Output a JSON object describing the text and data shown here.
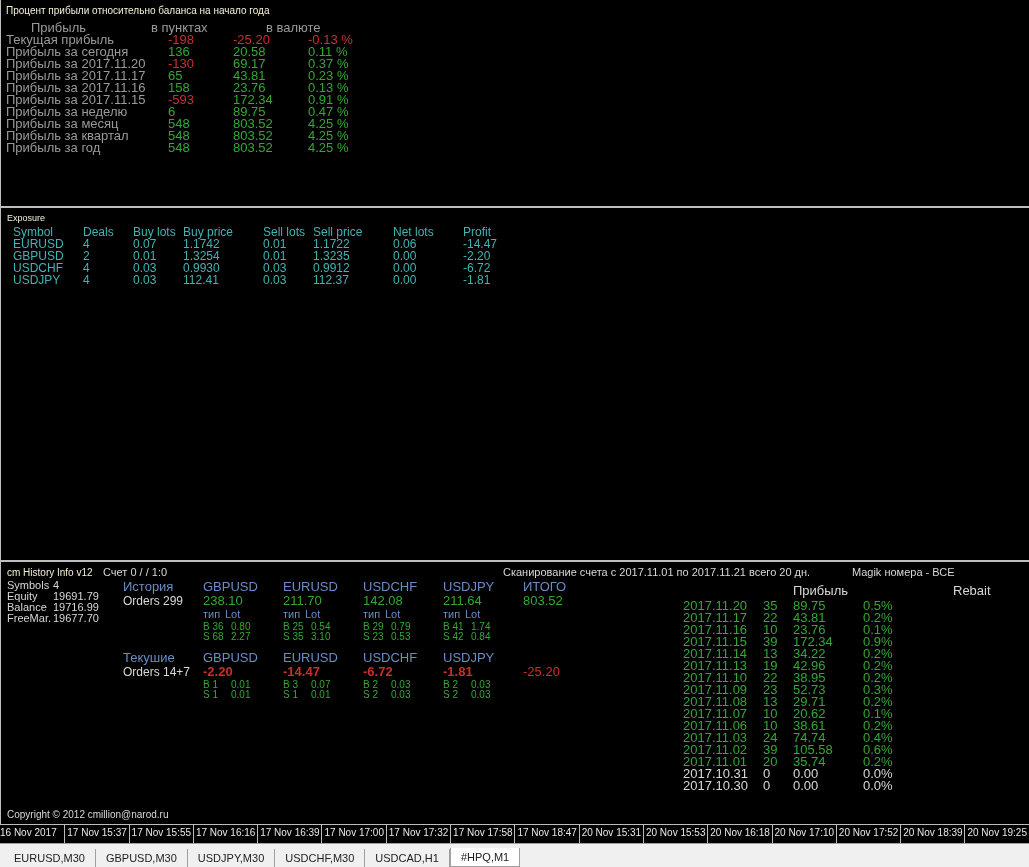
{
  "profit_panel": {
    "subtitle": "Процент прибыли относительно баланса на начало года",
    "headers": [
      "Прибыль",
      "в пунктах",
      "в валюте"
    ],
    "rows": [
      {
        "label": "Текущая прибыль",
        "cells": [
          {
            "text": "-198",
            "negative": true
          },
          {
            "text": "-25.20",
            "negative": true
          },
          {
            "text": "-0.13 %",
            "negative": true
          }
        ]
      },
      {
        "label": "Прибыль за сегодня",
        "cells": [
          {
            "text": "136",
            "negative": false
          },
          {
            "text": "20.58",
            "negative": false
          },
          {
            "text": "0.11 %",
            "negative": false
          }
        ]
      },
      {
        "label": "Прибыль за 2017.11.20",
        "cells": [
          {
            "text": "-130",
            "negative": true
          },
          {
            "text": "69.17",
            "negative": false
          },
          {
            "text": "0.37 %",
            "negative": false
          }
        ]
      },
      {
        "label": "Прибыль за 2017.11.17",
        "cells": [
          {
            "text": "65",
            "negative": false
          },
          {
            "text": "43.81",
            "negative": false
          },
          {
            "text": "0.23 %",
            "negative": false
          }
        ]
      },
      {
        "label": "Прибыль за 2017.11.16",
        "cells": [
          {
            "text": "158",
            "negative": false
          },
          {
            "text": "23.76",
            "negative": false
          },
          {
            "text": "0.13 %",
            "negative": false
          }
        ]
      },
      {
        "label": "Прибыль за 2017.11.15",
        "cells": [
          {
            "text": "-593",
            "negative": true
          },
          {
            "text": "172.34",
            "negative": false
          },
          {
            "text": "0.91 %",
            "negative": false
          }
        ]
      },
      {
        "label": "Прибыль за неделю",
        "cells": [
          {
            "text": "6",
            "negative": false
          },
          {
            "text": "89.75",
            "negative": false
          },
          {
            "text": "0.47 %",
            "negative": false
          }
        ]
      },
      {
        "label": "Прибыль за месяц",
        "cells": [
          {
            "text": "548",
            "negative": false
          },
          {
            "text": "803.52",
            "negative": false
          },
          {
            "text": "4.25 %",
            "negative": false
          }
        ]
      },
      {
        "label": "Прибыль за квартал",
        "cells": [
          {
            "text": "548",
            "negative": false
          },
          {
            "text": "803.52",
            "negative": false
          },
          {
            "text": "4.25 %",
            "negative": false
          }
        ]
      },
      {
        "label": "Прибыль за год",
        "cells": [
          {
            "text": "548",
            "negative": false
          },
          {
            "text": "803.52",
            "negative": false
          },
          {
            "text": "4.25 %",
            "negative": false
          }
        ]
      }
    ]
  },
  "exposure": {
    "title": "Exposure",
    "columns": [
      "Symbol",
      "Deals",
      "Buy lots",
      "Buy price",
      "Sell lots",
      "Sell price",
      "Net lots",
      "Profit"
    ],
    "rows": [
      [
        "EURUSD",
        "4",
        "0.07",
        "1.1742",
        "0.01",
        "1.1722",
        "0.06",
        "-14.47"
      ],
      [
        "GBPUSD",
        "2",
        "0.01",
        "1.3254",
        "0.01",
        "1.3235",
        "0.00",
        "-2.20"
      ],
      [
        "USDCHF",
        "4",
        "0.03",
        "0.9930",
        "0.03",
        "0.9912",
        "0.00",
        "-6.72"
      ],
      [
        "USDJPY",
        "4",
        "0.03",
        "112.41",
        "0.03",
        "112.37",
        "0.00",
        "-1.81"
      ]
    ]
  },
  "history_info": {
    "title": "cm History Info v12",
    "account": "Счет 0 /  / 1:0",
    "scan": "Сканирование счета с 2017.11.01 по 2017.11.21 всего 20 дн.",
    "magic": "Magik номера - ВСЕ",
    "stats": [
      {
        "label": "Symbols",
        "value": "4"
      },
      {
        "label": "Equity",
        "value": "19691.79"
      },
      {
        "label": "Balance",
        "value": "19716.99"
      },
      {
        "label": "FreeMar.",
        "value": "19677.70"
      }
    ],
    "sections": [
      {
        "title": "История",
        "orders": "Orders 299",
        "total_label": "ИТОГО",
        "total": "803.52",
        "total_negative": false,
        "symbols": [
          {
            "symbol": "GBPUSD",
            "value": "238.10",
            "negative": false,
            "line_headers": [
              "тип",
              "Lot"
            ],
            "lines": [
              [
                "B 36",
                "0.80"
              ],
              [
                "S 68",
                "2.27"
              ]
            ]
          },
          {
            "symbol": "EURUSD",
            "value": "211.70",
            "negative": false,
            "line_headers": [
              "тип",
              "Lot"
            ],
            "lines": [
              [
                "B 25",
                "0.54"
              ],
              [
                "S 35",
                "3.10"
              ]
            ]
          },
          {
            "symbol": "USDCHF",
            "value": "142.08",
            "negative": false,
            "line_headers": [
              "тип",
              "Lot"
            ],
            "lines": [
              [
                "B 29",
                "0.79"
              ],
              [
                "S 23",
                "0.53"
              ]
            ]
          },
          {
            "symbol": "USDJPY",
            "value": "211.64",
            "negative": false,
            "line_headers": [
              "тип",
              "Lot"
            ],
            "lines": [
              [
                "B 41",
                "1.74"
              ],
              [
                "S 42",
                "0.84"
              ]
            ]
          }
        ]
      },
      {
        "title": "Текушие",
        "orders": "Orders 14+7",
        "total": "-25.20",
        "total_negative": true,
        "symbols": [
          {
            "symbol": "GBPUSD",
            "value": "-2.20",
            "negative": true,
            "lines": [
              [
                "B 1",
                "0.01"
              ],
              [
                "S 1",
                "0.01"
              ]
            ]
          },
          {
            "symbol": "EURUSD",
            "value": "-14.47",
            "negative": true,
            "lines": [
              [
                "B 3",
                "0.07"
              ],
              [
                "S 1",
                "0.01"
              ]
            ]
          },
          {
            "symbol": "USDCHF",
            "value": "-6.72",
            "negative": true,
            "lines": [
              [
                "B 2",
                "0.03"
              ],
              [
                "S 2",
                "0.03"
              ]
            ]
          },
          {
            "symbol": "USDJPY",
            "value": "-1.81",
            "negative": true,
            "lines": [
              [
                "B 2",
                "0.03"
              ],
              [
                "S 2",
                "0.03"
              ]
            ]
          }
        ]
      }
    ],
    "daily": {
      "headers": [
        "Прибыль",
        "Rebait"
      ],
      "rows": [
        {
          "date": "2017.11.20",
          "deals": "35",
          "profit": "89.75",
          "percent": "0.5%",
          "has_trades": true
        },
        {
          "date": "2017.11.17",
          "deals": "22",
          "profit": "43.81",
          "percent": "0.2%",
          "has_trades": true
        },
        {
          "date": "2017.11.16",
          "deals": "10",
          "profit": "23.76",
          "percent": "0.1%",
          "has_trades": true
        },
        {
          "date": "2017.11.15",
          "deals": "39",
          "profit": "172.34",
          "percent": "0.9%",
          "has_trades": true
        },
        {
          "date": "2017.11.14",
          "deals": "13",
          "profit": "34.22",
          "percent": "0.2%",
          "has_trades": true
        },
        {
          "date": "2017.11.13",
          "deals": "19",
          "profit": "42.96",
          "percent": "0.2%",
          "has_trades": true
        },
        {
          "date": "2017.11.10",
          "deals": "22",
          "profit": "38.95",
          "percent": "0.2%",
          "has_trades": true
        },
        {
          "date": "2017.11.09",
          "deals": "23",
          "profit": "52.73",
          "percent": "0.3%",
          "has_trades": true
        },
        {
          "date": "2017.11.08",
          "deals": "13",
          "profit": "29.71",
          "percent": "0.2%",
          "has_trades": true
        },
        {
          "date": "2017.11.07",
          "deals": "10",
          "profit": "20.62",
          "percent": "0.1%",
          "has_trades": true
        },
        {
          "date": "2017.11.06",
          "deals": "10",
          "profit": "38.61",
          "percent": "0.2%",
          "has_trades": true
        },
        {
          "date": "2017.11.03",
          "deals": "24",
          "profit": "74.74",
          "percent": "0.4%",
          "has_trades": true
        },
        {
          "date": "2017.11.02",
          "deals": "39",
          "profit": "105.58",
          "percent": "0.6%",
          "has_trades": true
        },
        {
          "date": "2017.11.01",
          "deals": "20",
          "profit": "35.74",
          "percent": "0.2%",
          "has_trades": true
        },
        {
          "date": "2017.10.31",
          "deals": "0",
          "profit": "0.00",
          "percent": "0.0%",
          "has_trades": false
        },
        {
          "date": "2017.10.30",
          "deals": "0",
          "profit": "0.00",
          "percent": "0.0%",
          "has_trades": false
        }
      ]
    },
    "copyright": "Copyright © 2012 cmillion@narod.ru"
  },
  "time_axis": [
    "16 Nov 2017",
    "17 Nov 15:37",
    "17 Nov 15:55",
    "17 Nov 16:16",
    "17 Nov 16:39",
    "17 Nov 17:00",
    "17 Nov 17:32",
    "17 Nov 17:58",
    "17 Nov 18:47",
    "20 Nov 15:31",
    "20 Nov 15:53",
    "20 Nov 16:18",
    "20 Nov 17:10",
    "20 Nov 17:52",
    "20 Nov 18:39",
    "20 Nov 19:25"
  ],
  "chart_tabs": [
    {
      "label": "EURUSD,M30",
      "selected": false
    },
    {
      "label": "GBPUSD,M30",
      "selected": false
    },
    {
      "label": "USDJPY,M30",
      "selected": false
    },
    {
      "label": "USDCHF,M30",
      "selected": false
    },
    {
      "label": "USDCAD,H1",
      "selected": false
    },
    {
      "label": "#HPQ,M1",
      "selected": true
    }
  ]
}
